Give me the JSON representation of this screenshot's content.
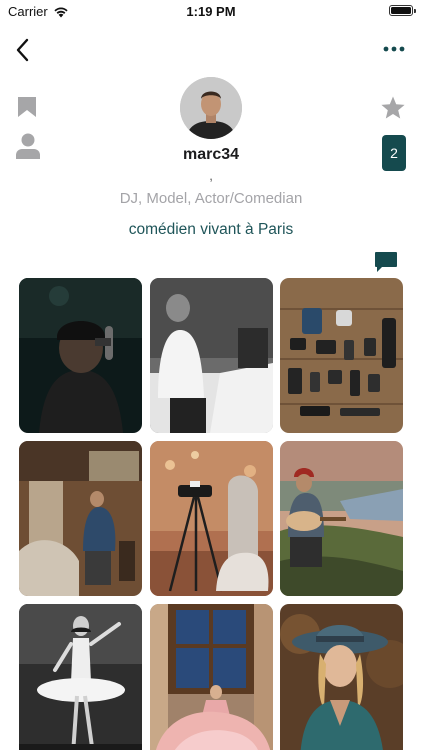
{
  "status_bar": {
    "carrier": "Carrier",
    "time": "1:19 PM"
  },
  "profile": {
    "username": "marc34",
    "location": ",",
    "roles": "DJ, Model, Actor/Comedian",
    "bio": "comédien vivant à Paris",
    "badge_count": "2"
  },
  "icons": {
    "back": "chevron-left-icon",
    "more": "ellipsis-icon",
    "bookmark": "bookmark-icon",
    "user": "user-icon",
    "star": "star-icon",
    "message": "message-icon"
  },
  "colors": {
    "accent": "#154a4e",
    "text_muted": "#a4a4a8",
    "bio": "#1f5559",
    "icon_grey": "#a6a6a8"
  },
  "photos": [
    {
      "subject": "man in cap at microphone"
    },
    {
      "subject": "man in white shirt at table"
    },
    {
      "subject": "camera gear flat lay"
    },
    {
      "subject": "sculptor in workshop"
    },
    {
      "subject": "photographer with tripod"
    },
    {
      "subject": "man playing guitar on cliff"
    },
    {
      "subject": "ballerina in tutu"
    },
    {
      "subject": "woman in pink gown by window"
    },
    {
      "subject": "woman in blue hat"
    }
  ]
}
